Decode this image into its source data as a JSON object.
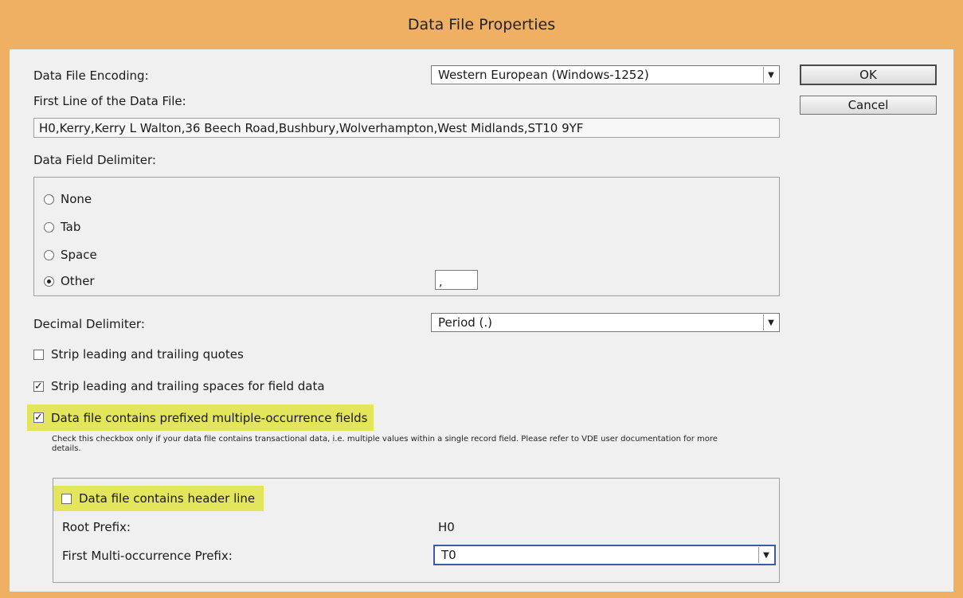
{
  "window": {
    "title": "Data File Properties"
  },
  "encoding": {
    "label": "Data File Encoding:",
    "value": "Western European (Windows-1252)"
  },
  "buttons": {
    "ok": "OK",
    "cancel": "Cancel"
  },
  "first_line": {
    "label": "First Line of the Data File:",
    "value": "H0,Kerry,Kerry L Walton,36 Beech Road,Bushbury,Wolverhampton,West Midlands,ST10 9YF"
  },
  "field_delimiter": {
    "label": "Data Field Delimiter:",
    "options": [
      {
        "label": "None",
        "selected": false
      },
      {
        "label": "Tab",
        "selected": false
      },
      {
        "label": "Space",
        "selected": false
      },
      {
        "label": "Other",
        "selected": true
      }
    ],
    "other_value": ","
  },
  "decimal_delimiter": {
    "label": "Decimal Delimiter:",
    "value": "Period (.)"
  },
  "checkboxes": {
    "strip_quotes": {
      "label": "Strip leading and trailing quotes",
      "checked": false
    },
    "strip_spaces": {
      "label": "Strip leading and trailing spaces for field data",
      "checked": true
    },
    "multi_occurrence": {
      "label": "Data file contains prefixed multiple-occurrence fields",
      "checked": true
    },
    "header_line": {
      "label": "Data file contains header line",
      "checked": false
    }
  },
  "help_text": "Check this checkbox only if your data file contains transactional data, i.e. multiple values within a single record field. Please refer to VDE user documentation for more details.",
  "prefix": {
    "root_label": "Root Prefix:",
    "root_value": "H0",
    "first_multi_label": "First Multi-occurrence Prefix:",
    "first_multi_value": "T0"
  },
  "colors": {
    "titlebar": "#f0b064",
    "highlight": "#e3e55c",
    "focus_border": "#3b5ba5"
  }
}
